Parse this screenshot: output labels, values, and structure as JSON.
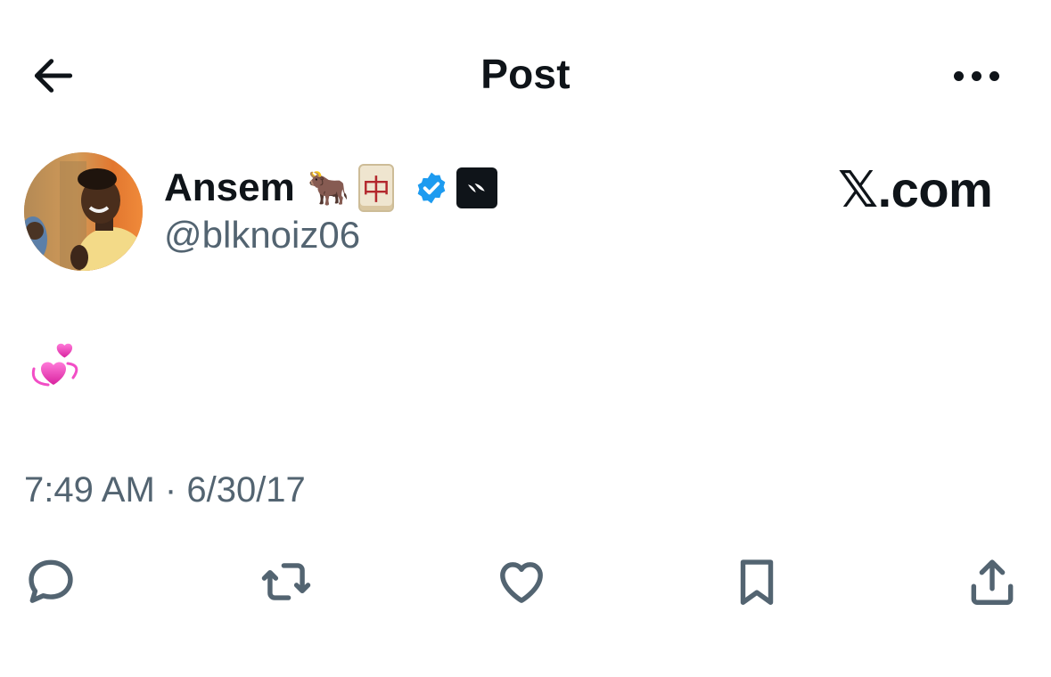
{
  "header": {
    "title": "Post",
    "back_icon": "arrow-left-icon",
    "more_icon": "more-horizontal-icon"
  },
  "author": {
    "display_name": "Ansem",
    "emoji_cow": "🐂",
    "emoji_mahjong": "中",
    "handle": "@blknoiz06",
    "verified": true,
    "badge_color": "#1d9bf0"
  },
  "watermark": "𝕏.com",
  "post": {
    "text": "💞",
    "time": "7:49 AM",
    "separator": "·",
    "date": "6/30/17"
  },
  "actions": {
    "reply_icon": "reply-icon",
    "repost_icon": "repost-icon",
    "like_icon": "heart-icon",
    "bookmark_icon": "bookmark-icon",
    "share_icon": "share-icon"
  },
  "colors": {
    "text_primary": "#0f1419",
    "text_secondary": "#536471",
    "verified_blue": "#1d9bf0"
  }
}
